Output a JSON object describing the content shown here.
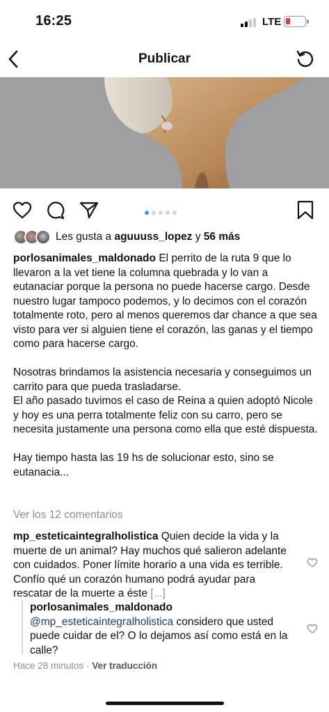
{
  "status_bar": {
    "time": "16:25",
    "network": "LTE",
    "battery_color": "#e23b3b"
  },
  "header": {
    "title": "Publicar",
    "back_icon": "chevron-left-icon",
    "refresh_icon": "refresh-icon"
  },
  "post": {
    "carousel": {
      "total": 5,
      "active_index": 0,
      "active_color": "#3897f0"
    },
    "likes": {
      "prefix": "Les gusta a",
      "user": "aguuuss_lopez",
      "connector": "y",
      "count_text": "56 más"
    },
    "caption": {
      "username": "porlosanimales_maldonado",
      "paragraph1": "El perrito de la ruta 9 que lo llevaron a la vet tiene la columna quebrada y lo van a eutanaciar porque la persona no puede hacerse cargo. Desde nuestro lugar tampoco podemos, y lo decimos con el corazón totalmente roto, pero al menos queremos dar chance a que sea visto para ver si alguien tiene el corazón, las ganas y el tiempo como para hacerse cargo.",
      "paragraph2": "Nosotras brindamos la asistencia necesaria y conseguimos un carrito para que pueda trasladarse.",
      "paragraph3": "El año pasado tuvimos el caso de Reina a quien adoptó Nicole y hoy es una perra totalmente feliz con su carro, pero se necesita justamente una persona como ella que esté dispuesta.",
      "paragraph4": "Hay tiempo hasta las 19 hs de solucionar esto, sino se eutanacia..."
    },
    "view_comments": "Ver los 12 comentarios",
    "comment": {
      "username": "mp_esteticaintegralholistica",
      "text": "Quien decide la vida y la muerte de un animal? Hay muchos qué salieron adelante con cuidados. Poner límite horario a una vida es terrible. Confío qué un corazón humano podrá ayudar para rescatar de la muerte a éste",
      "more": "[...]"
    },
    "reply": {
      "username": "porlosanimales_maldonado",
      "mention": "@mp_esteticaintegralholistica",
      "text": "considero que usted puede cuidar de el? O lo dejamos así como está en la calle?"
    },
    "meta": {
      "time": "Hace 28 minutos",
      "separator": "·",
      "translate": "Ver traducción"
    }
  }
}
